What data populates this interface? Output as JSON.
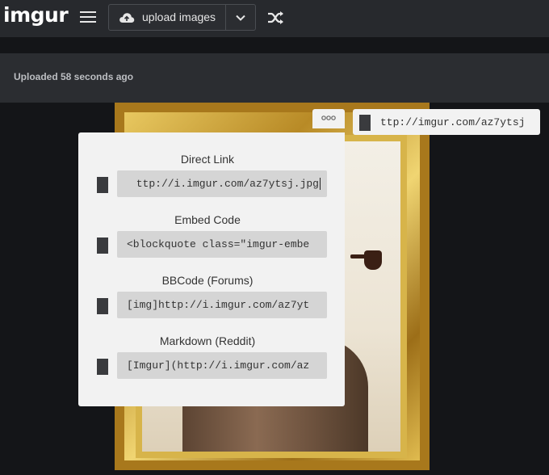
{
  "header": {
    "logo": "imgur",
    "upload_label": "upload images"
  },
  "status": {
    "uploaded_text": "Uploaded 58 seconds ago"
  },
  "share": {
    "url_partial": "ttp://imgur.com/az7ytsj"
  },
  "embed_panel": {
    "sections": [
      {
        "label": "Direct Link",
        "value": "ttp://i.imgur.com/az7ytsj.jpg"
      },
      {
        "label": "Embed Code",
        "value": "<blockquote class=\"imgur-embe"
      },
      {
        "label": "BBCode (Forums)",
        "value": "[img]http://i.imgur.com/az7yt"
      },
      {
        "label": "Markdown (Reddit)",
        "value": "[Imgur](http://i.imgur.com/az"
      }
    ]
  },
  "icons": {
    "menu": "hamburger-icon",
    "upload": "cloud-upload-icon",
    "dropdown": "chevron-down-icon",
    "random": "shuffle-icon",
    "options": "more-dots-icon"
  },
  "colors": {
    "topbar": "#27292d",
    "background": "#141518",
    "panel": "#f2f2f2",
    "input": "#d5d5d5"
  }
}
